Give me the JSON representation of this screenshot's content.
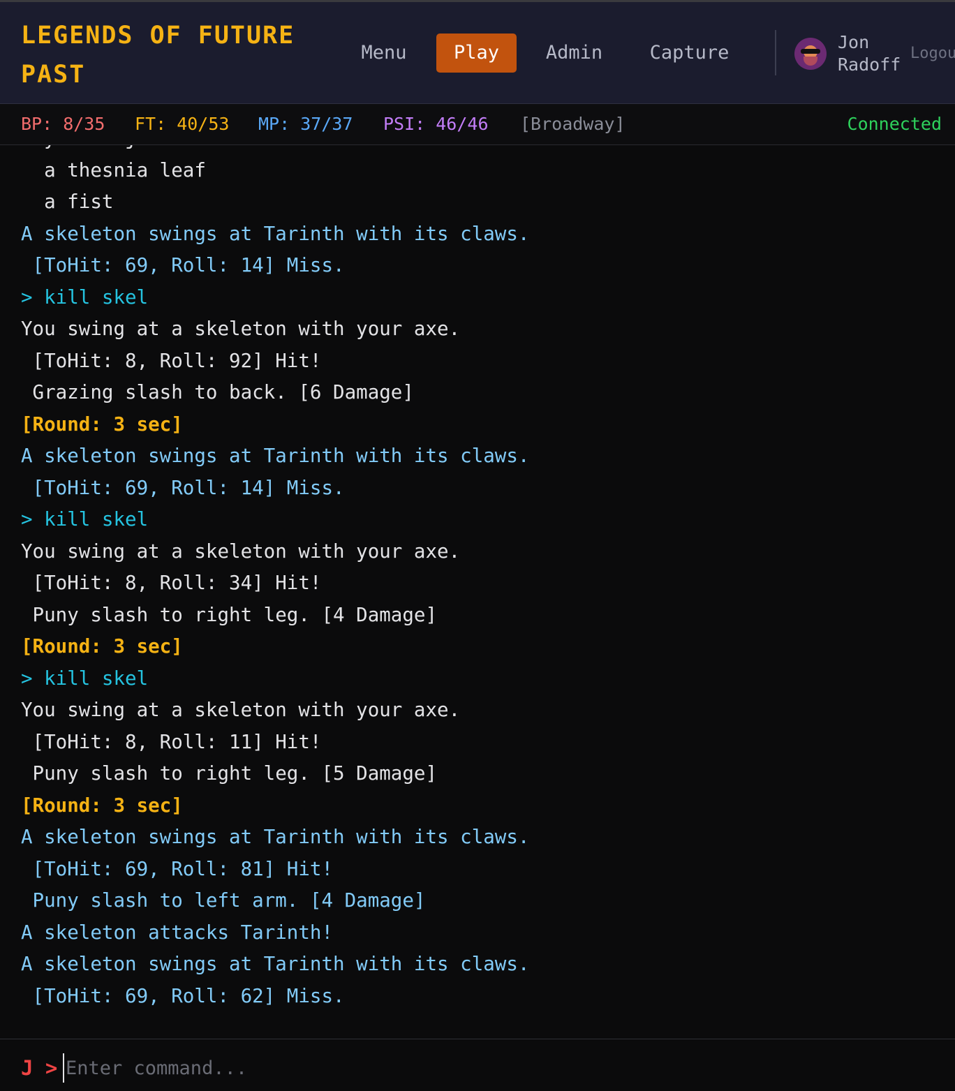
{
  "header": {
    "title": "LEGENDS OF FUTURE PAST",
    "nav": [
      {
        "label": "Menu"
      },
      {
        "label": "Play",
        "active": true
      },
      {
        "label": "Admin"
      },
      {
        "label": "Capture"
      }
    ],
    "user": {
      "name": "Jon Radoff",
      "logout": "Logou"
    }
  },
  "status": {
    "bp": "BP: 8/35",
    "ft": "FT: 40/53",
    "mp": "MP: 37/37",
    "psi": "PSI: 46/46",
    "room": "[Broadway]",
    "connection": "Connected"
  },
  "log": [
    {
      "text": "  your object",
      "kind": "w"
    },
    {
      "text": "  a thesnia leaf",
      "kind": "w"
    },
    {
      "text": "  a fist",
      "kind": "w"
    },
    {
      "text": "A skeleton swings at Tarinth with its claws.",
      "kind": "b"
    },
    {
      "text": " [ToHit: 69, Roll: 14] Miss.",
      "kind": "b"
    },
    {
      "text": "> kill skel",
      "kind": "cmd"
    },
    {
      "text": "You swing at a skeleton with your axe.",
      "kind": "w"
    },
    {
      "text": " [ToHit: 8, Roll: 92] Hit!",
      "kind": "w"
    },
    {
      "text": " Grazing slash to back. [6 Damage]",
      "kind": "w"
    },
    {
      "text": "[Round: 3 sec]",
      "kind": "y"
    },
    {
      "text": "A skeleton swings at Tarinth with its claws.",
      "kind": "b"
    },
    {
      "text": " [ToHit: 69, Roll: 14] Miss.",
      "kind": "b"
    },
    {
      "text": "> kill skel",
      "kind": "cmd"
    },
    {
      "text": "You swing at a skeleton with your axe.",
      "kind": "w"
    },
    {
      "text": " [ToHit: 8, Roll: 34] Hit!",
      "kind": "w"
    },
    {
      "text": " Puny slash to right leg. [4 Damage]",
      "kind": "w"
    },
    {
      "text": "[Round: 3 sec]",
      "kind": "y"
    },
    {
      "text": "> kill skel",
      "kind": "cmd"
    },
    {
      "text": "You swing at a skeleton with your axe.",
      "kind": "w"
    },
    {
      "text": " [ToHit: 8, Roll: 11] Hit!",
      "kind": "w"
    },
    {
      "text": " Puny slash to right leg. [5 Damage]",
      "kind": "w"
    },
    {
      "text": "[Round: 3 sec]",
      "kind": "y"
    },
    {
      "text": "A skeleton swings at Tarinth with its claws.",
      "kind": "b"
    },
    {
      "text": " [ToHit: 69, Roll: 81] Hit!",
      "kind": "b"
    },
    {
      "text": " Puny slash to left arm. [4 Damage]",
      "kind": "b"
    },
    {
      "text": "A skeleton attacks Tarinth!",
      "kind": "b"
    },
    {
      "text": "A skeleton swings at Tarinth with its claws.",
      "kind": "b"
    },
    {
      "text": " [ToHit: 69, Roll: 62] Miss.",
      "kind": "b"
    }
  ],
  "input": {
    "prompt": "J >",
    "placeholder": "Enter command...",
    "value": ""
  },
  "icons": {
    "avatar": "user-avatar"
  }
}
